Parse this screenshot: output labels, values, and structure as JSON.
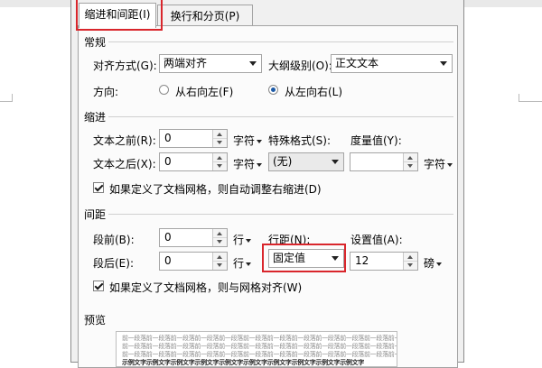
{
  "tabs": [
    {
      "label": "缩进和间距(I)",
      "active": true
    },
    {
      "label": "换行和分页(P)",
      "active": false
    }
  ],
  "general": {
    "title": "常规",
    "alignment_label": "对齐方式(G):",
    "alignment_value": "两端对齐",
    "outline_label": "大纲级别(O):",
    "outline_value": "正文文本",
    "direction_label": "方向:",
    "rtl_label": "从右向左(F)",
    "ltr_label": "从左向右(L)",
    "direction_selected": "ltr"
  },
  "indent": {
    "title": "缩进",
    "before_label": "文本之前(R):",
    "before_value": "0",
    "before_unit": "字符",
    "after_label": "文本之后(X):",
    "after_value": "0",
    "after_unit": "字符",
    "special_label": "特殊格式(S):",
    "special_value": "(无)",
    "measure_label": "度量值(Y):",
    "measure_value": "",
    "measure_unit": "字符",
    "grid_check_label": "如果定义了文档网格，则自动调整右缩进(D)",
    "grid_check_checked": true
  },
  "spacing": {
    "title": "间距",
    "before_label": "段前(B):",
    "before_value": "0",
    "before_unit": "行",
    "after_label": "段后(E):",
    "after_value": "0",
    "after_unit": "行",
    "line_label": "行距(N):",
    "line_value": "固定值",
    "setting_label": "设置值(A):",
    "setting_value": "12",
    "setting_unit": "磅",
    "grid_check_label": "如果定义了文档网格，则与网格对齐(W)",
    "grid_check_checked": true
  },
  "preview": {
    "title": "预览",
    "prev_text": "前一段落前一段落前一段落前一段落前一段落前一段落前一段落前一段落前一段落前一段落前一段落前一段落",
    "body_text": "示例文字示例文字示例文字示例文字示例文字示例文字示例文字示例文字示例文字示例文字"
  },
  "colors": {
    "highlight": "#d9262c",
    "radio_selected": "#1c5aa6"
  }
}
